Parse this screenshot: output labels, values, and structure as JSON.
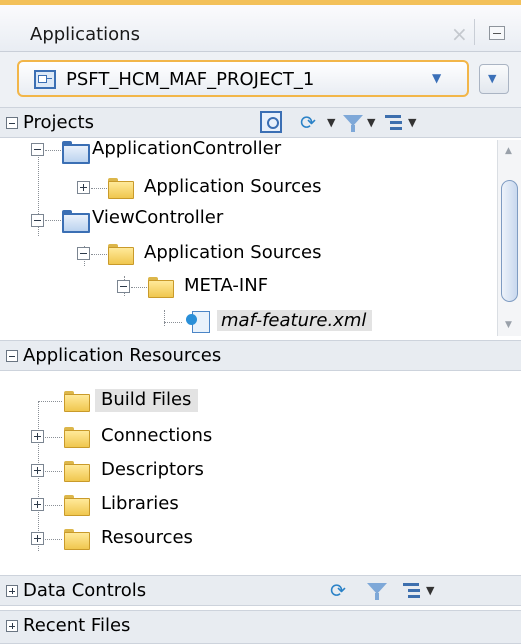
{
  "panel": {
    "title": "Applications",
    "close_icon": "close-icon",
    "minimize_icon": "minimize-icon"
  },
  "project_selector": {
    "value": "PSFT_HCM_MAF_PROJECT_1",
    "icon": "project-icon",
    "accent": "#f2b649"
  },
  "projects": {
    "label": "Projects",
    "toolbar_icons": [
      "find-icon",
      "sync-icon",
      "filter-icon",
      "tree-view-icon"
    ],
    "tree": [
      {
        "label": "ApplicationController"
      },
      {
        "label": "Application Sources"
      },
      {
        "label": "ViewController"
      },
      {
        "label": "Application Sources"
      },
      {
        "label": "META-INF"
      },
      {
        "label": "maf-feature.xml"
      }
    ]
  },
  "application_resources": {
    "label": "Application Resources",
    "tree": [
      {
        "label": "Build Files"
      },
      {
        "label": "Connections"
      },
      {
        "label": "Descriptors"
      },
      {
        "label": "Libraries"
      },
      {
        "label": "Resources"
      }
    ]
  },
  "data_controls": {
    "label": "Data Controls",
    "toolbar_icons": [
      "sync-icon",
      "filter-icon",
      "tree-view-icon"
    ]
  },
  "recent_files": {
    "label": "Recent Files"
  }
}
